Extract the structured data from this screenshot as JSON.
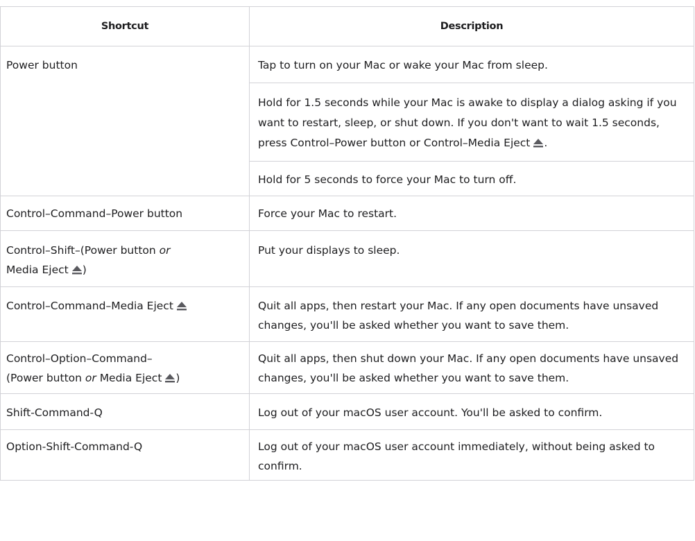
{
  "table": {
    "headers": {
      "shortcut": "Shortcut",
      "description": "Description"
    },
    "rows": [
      {
        "shortcut": "Power button",
        "description": "Tap to turn on your Mac or wake your Mac from sleep."
      },
      {
        "description": "Hold for 1.5 seconds while your Mac is awake to display a dialog asking if you want to restart, sleep, or shut down. If you don't want to wait 1.5 seconds, press Control–Power button or Control–Media Eject",
        "description_tail": "."
      },
      {
        "description": "Hold for 5 seconds to force your Mac to turn off."
      },
      {
        "shortcut": "Control–Command–Power button",
        "description": "Force your Mac to restart."
      },
      {
        "shortcut_prefix": "Control–Shift–(Power button ",
        "shortcut_or": "or",
        "shortcut_suffix": "Media Eject",
        "shortcut_close": ")",
        "description": "Put your displays to sleep."
      },
      {
        "shortcut": "Control–Command–Media Eject",
        "description": "Quit all apps, then restart your Mac. If any open documents have unsaved changes, you'll be asked whether you want to save them."
      },
      {
        "shortcut_line1": "Control–Option–Command–",
        "shortcut_prefix": "(Power button ",
        "shortcut_or": "or",
        "shortcut_suffix": "Media Eject",
        "shortcut_close": ")",
        "description": "Quit all apps, then shut down your Mac. If any open documents have unsaved changes, you'll be asked whether you want to save them."
      },
      {
        "shortcut": "Shift-Command-Q",
        "description": "Log out of your macOS user account. You'll be asked to confirm."
      },
      {
        "shortcut": "Option-Shift-Command-Q",
        "description": "Log out of your macOS user account immediately, without being asked to confirm."
      }
    ]
  },
  "icons": {
    "eject": "eject-icon"
  },
  "colors": {
    "border": "#d2d2d7",
    "text": "#1d1d1f",
    "icon": "#5a5a5f"
  }
}
